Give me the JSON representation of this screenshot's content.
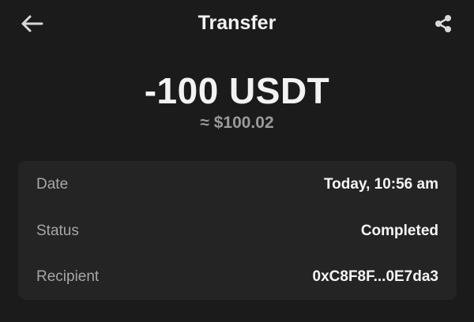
{
  "header": {
    "title": "Transfer",
    "back_icon": "arrow-left-icon",
    "share_icon": "share-icon"
  },
  "amount": {
    "primary": "-100 USDT",
    "fiat": "≈ $100.02"
  },
  "details": [
    {
      "label": "Date",
      "value": "Today, 10:56 am"
    },
    {
      "label": "Status",
      "value": "Completed"
    },
    {
      "label": "Recipient",
      "value": "0xC8F8F...0E7da3"
    }
  ],
  "colors": {
    "background": "#1b1b1b",
    "card": "#242424",
    "label": "#a6a6a6",
    "value": "#f5f5f5",
    "fiat": "#9a9a9a"
  }
}
